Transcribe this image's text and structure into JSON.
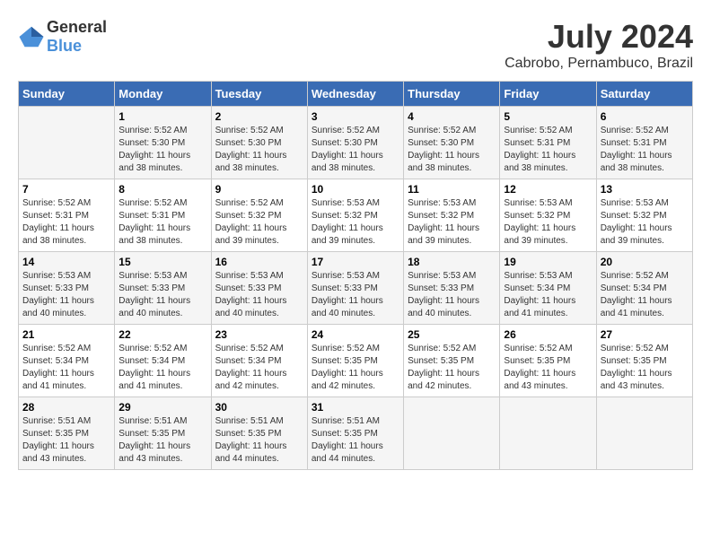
{
  "logo": {
    "general": "General",
    "blue": "Blue"
  },
  "title": {
    "month_year": "July 2024",
    "location": "Cabrobo, Pernambuco, Brazil"
  },
  "header_days": [
    "Sunday",
    "Monday",
    "Tuesday",
    "Wednesday",
    "Thursday",
    "Friday",
    "Saturday"
  ],
  "weeks": [
    [
      {
        "day": "",
        "sunrise": "",
        "sunset": "",
        "daylight": ""
      },
      {
        "day": "1",
        "sunrise": "Sunrise: 5:52 AM",
        "sunset": "Sunset: 5:30 PM",
        "daylight": "Daylight: 11 hours and 38 minutes."
      },
      {
        "day": "2",
        "sunrise": "Sunrise: 5:52 AM",
        "sunset": "Sunset: 5:30 PM",
        "daylight": "Daylight: 11 hours and 38 minutes."
      },
      {
        "day": "3",
        "sunrise": "Sunrise: 5:52 AM",
        "sunset": "Sunset: 5:30 PM",
        "daylight": "Daylight: 11 hours and 38 minutes."
      },
      {
        "day": "4",
        "sunrise": "Sunrise: 5:52 AM",
        "sunset": "Sunset: 5:30 PM",
        "daylight": "Daylight: 11 hours and 38 minutes."
      },
      {
        "day": "5",
        "sunrise": "Sunrise: 5:52 AM",
        "sunset": "Sunset: 5:31 PM",
        "daylight": "Daylight: 11 hours and 38 minutes."
      },
      {
        "day": "6",
        "sunrise": "Sunrise: 5:52 AM",
        "sunset": "Sunset: 5:31 PM",
        "daylight": "Daylight: 11 hours and 38 minutes."
      }
    ],
    [
      {
        "day": "7",
        "sunrise": "Sunrise: 5:52 AM",
        "sunset": "Sunset: 5:31 PM",
        "daylight": "Daylight: 11 hours and 38 minutes."
      },
      {
        "day": "8",
        "sunrise": "Sunrise: 5:52 AM",
        "sunset": "Sunset: 5:31 PM",
        "daylight": "Daylight: 11 hours and 38 minutes."
      },
      {
        "day": "9",
        "sunrise": "Sunrise: 5:52 AM",
        "sunset": "Sunset: 5:32 PM",
        "daylight": "Daylight: 11 hours and 39 minutes."
      },
      {
        "day": "10",
        "sunrise": "Sunrise: 5:53 AM",
        "sunset": "Sunset: 5:32 PM",
        "daylight": "Daylight: 11 hours and 39 minutes."
      },
      {
        "day": "11",
        "sunrise": "Sunrise: 5:53 AM",
        "sunset": "Sunset: 5:32 PM",
        "daylight": "Daylight: 11 hours and 39 minutes."
      },
      {
        "day": "12",
        "sunrise": "Sunrise: 5:53 AM",
        "sunset": "Sunset: 5:32 PM",
        "daylight": "Daylight: 11 hours and 39 minutes."
      },
      {
        "day": "13",
        "sunrise": "Sunrise: 5:53 AM",
        "sunset": "Sunset: 5:32 PM",
        "daylight": "Daylight: 11 hours and 39 minutes."
      }
    ],
    [
      {
        "day": "14",
        "sunrise": "Sunrise: 5:53 AM",
        "sunset": "Sunset: 5:33 PM",
        "daylight": "Daylight: 11 hours and 40 minutes."
      },
      {
        "day": "15",
        "sunrise": "Sunrise: 5:53 AM",
        "sunset": "Sunset: 5:33 PM",
        "daylight": "Daylight: 11 hours and 40 minutes."
      },
      {
        "day": "16",
        "sunrise": "Sunrise: 5:53 AM",
        "sunset": "Sunset: 5:33 PM",
        "daylight": "Daylight: 11 hours and 40 minutes."
      },
      {
        "day": "17",
        "sunrise": "Sunrise: 5:53 AM",
        "sunset": "Sunset: 5:33 PM",
        "daylight": "Daylight: 11 hours and 40 minutes."
      },
      {
        "day": "18",
        "sunrise": "Sunrise: 5:53 AM",
        "sunset": "Sunset: 5:33 PM",
        "daylight": "Daylight: 11 hours and 40 minutes."
      },
      {
        "day": "19",
        "sunrise": "Sunrise: 5:53 AM",
        "sunset": "Sunset: 5:34 PM",
        "daylight": "Daylight: 11 hours and 41 minutes."
      },
      {
        "day": "20",
        "sunrise": "Sunrise: 5:52 AM",
        "sunset": "Sunset: 5:34 PM",
        "daylight": "Daylight: 11 hours and 41 minutes."
      }
    ],
    [
      {
        "day": "21",
        "sunrise": "Sunrise: 5:52 AM",
        "sunset": "Sunset: 5:34 PM",
        "daylight": "Daylight: 11 hours and 41 minutes."
      },
      {
        "day": "22",
        "sunrise": "Sunrise: 5:52 AM",
        "sunset": "Sunset: 5:34 PM",
        "daylight": "Daylight: 11 hours and 41 minutes."
      },
      {
        "day": "23",
        "sunrise": "Sunrise: 5:52 AM",
        "sunset": "Sunset: 5:34 PM",
        "daylight": "Daylight: 11 hours and 42 minutes."
      },
      {
        "day": "24",
        "sunrise": "Sunrise: 5:52 AM",
        "sunset": "Sunset: 5:35 PM",
        "daylight": "Daylight: 11 hours and 42 minutes."
      },
      {
        "day": "25",
        "sunrise": "Sunrise: 5:52 AM",
        "sunset": "Sunset: 5:35 PM",
        "daylight": "Daylight: 11 hours and 42 minutes."
      },
      {
        "day": "26",
        "sunrise": "Sunrise: 5:52 AM",
        "sunset": "Sunset: 5:35 PM",
        "daylight": "Daylight: 11 hours and 43 minutes."
      },
      {
        "day": "27",
        "sunrise": "Sunrise: 5:52 AM",
        "sunset": "Sunset: 5:35 PM",
        "daylight": "Daylight: 11 hours and 43 minutes."
      }
    ],
    [
      {
        "day": "28",
        "sunrise": "Sunrise: 5:51 AM",
        "sunset": "Sunset: 5:35 PM",
        "daylight": "Daylight: 11 hours and 43 minutes."
      },
      {
        "day": "29",
        "sunrise": "Sunrise: 5:51 AM",
        "sunset": "Sunset: 5:35 PM",
        "daylight": "Daylight: 11 hours and 43 minutes."
      },
      {
        "day": "30",
        "sunrise": "Sunrise: 5:51 AM",
        "sunset": "Sunset: 5:35 PM",
        "daylight": "Daylight: 11 hours and 44 minutes."
      },
      {
        "day": "31",
        "sunrise": "Sunrise: 5:51 AM",
        "sunset": "Sunset: 5:35 PM",
        "daylight": "Daylight: 11 hours and 44 minutes."
      },
      {
        "day": "",
        "sunrise": "",
        "sunset": "",
        "daylight": ""
      },
      {
        "day": "",
        "sunrise": "",
        "sunset": "",
        "daylight": ""
      },
      {
        "day": "",
        "sunrise": "",
        "sunset": "",
        "daylight": ""
      }
    ]
  ]
}
